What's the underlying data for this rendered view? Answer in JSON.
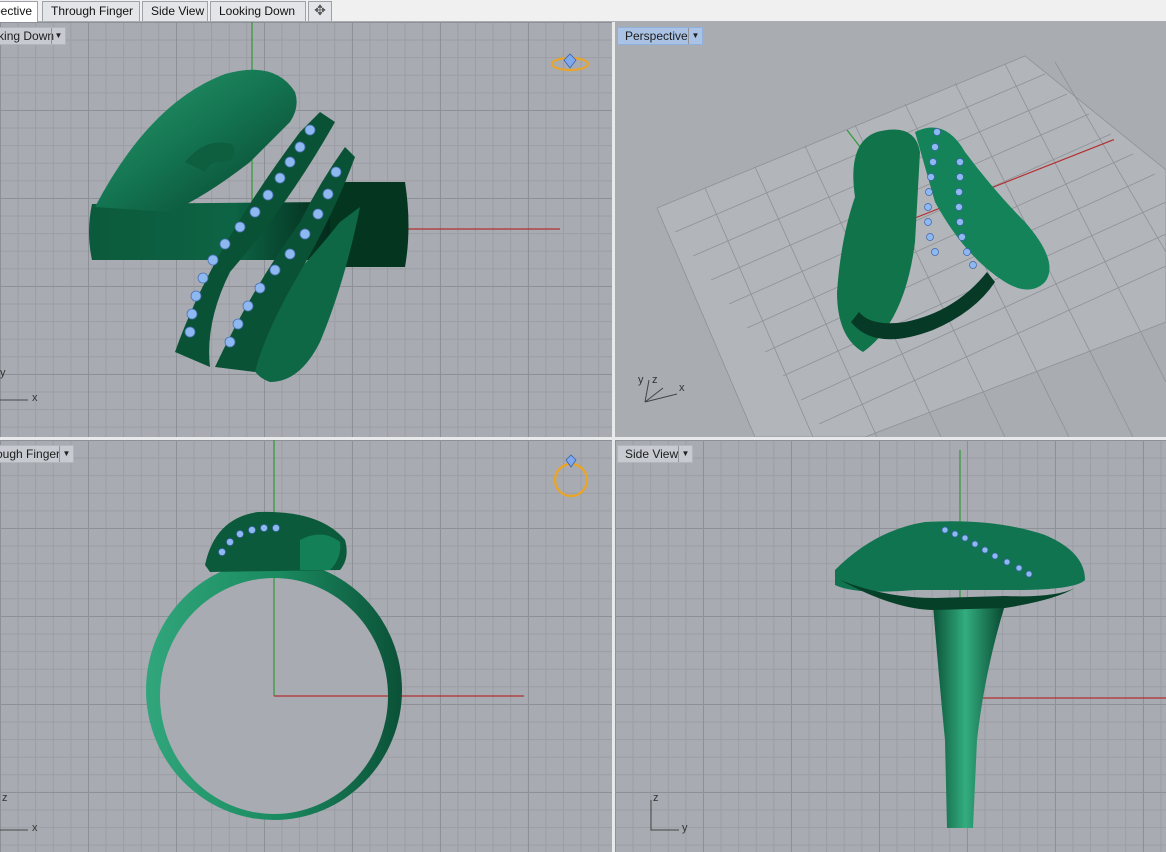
{
  "tabs": [
    {
      "label": "Perspective",
      "active": true
    },
    {
      "label": "Through Finger",
      "active": false
    },
    {
      "label": "Side View",
      "active": false
    },
    {
      "label": "Looking Down",
      "active": false
    }
  ],
  "add_tab_icon": "plus-icon",
  "viewports": {
    "top_left": {
      "label": "Looking Down",
      "axes": [
        "x",
        "y"
      ]
    },
    "top_right": {
      "label": "Perspective",
      "axes": [
        "x",
        "y",
        "z"
      ],
      "active": true
    },
    "bottom_left": {
      "label": "Through Finger",
      "axes": [
        "x",
        "z"
      ]
    },
    "bottom_right": {
      "label": "Side View",
      "axes": [
        "y",
        "z"
      ]
    }
  },
  "colors": {
    "ring_green": "#167a55",
    "gem_blue": "#8db8f0",
    "active_viewport": "#aac2e3",
    "axis_red": "#b23030",
    "axis_green": "#2f9a3a",
    "badge_gold": "#e8a52a"
  }
}
